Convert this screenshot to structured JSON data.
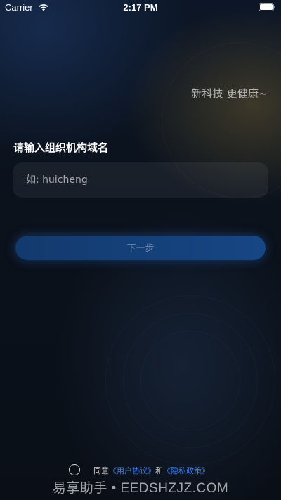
{
  "status_bar": {
    "carrier": "Carrier",
    "time": "2:17 PM",
    "wifi_icon": "wifi-icon",
    "battery_icon": "battery-icon"
  },
  "tagline": "新科技 更健康~",
  "form": {
    "label": "请输入组织机构域名",
    "input_placeholder": "如: huicheng",
    "input_value": "",
    "next_label": "下一步"
  },
  "agreement": {
    "prefix": "同意",
    "user_agreement": "《用户协议》",
    "conjunction": "和",
    "privacy_policy": "《隐私政策》",
    "checked": false
  },
  "watermark": "易享助手 • EEDSHZJZ.COM",
  "colors": {
    "background": "#0a0f18",
    "button": "#164684",
    "button_text": "#6a86ad",
    "link": "#3b7ff0",
    "tagline": "#b8b8b8"
  }
}
